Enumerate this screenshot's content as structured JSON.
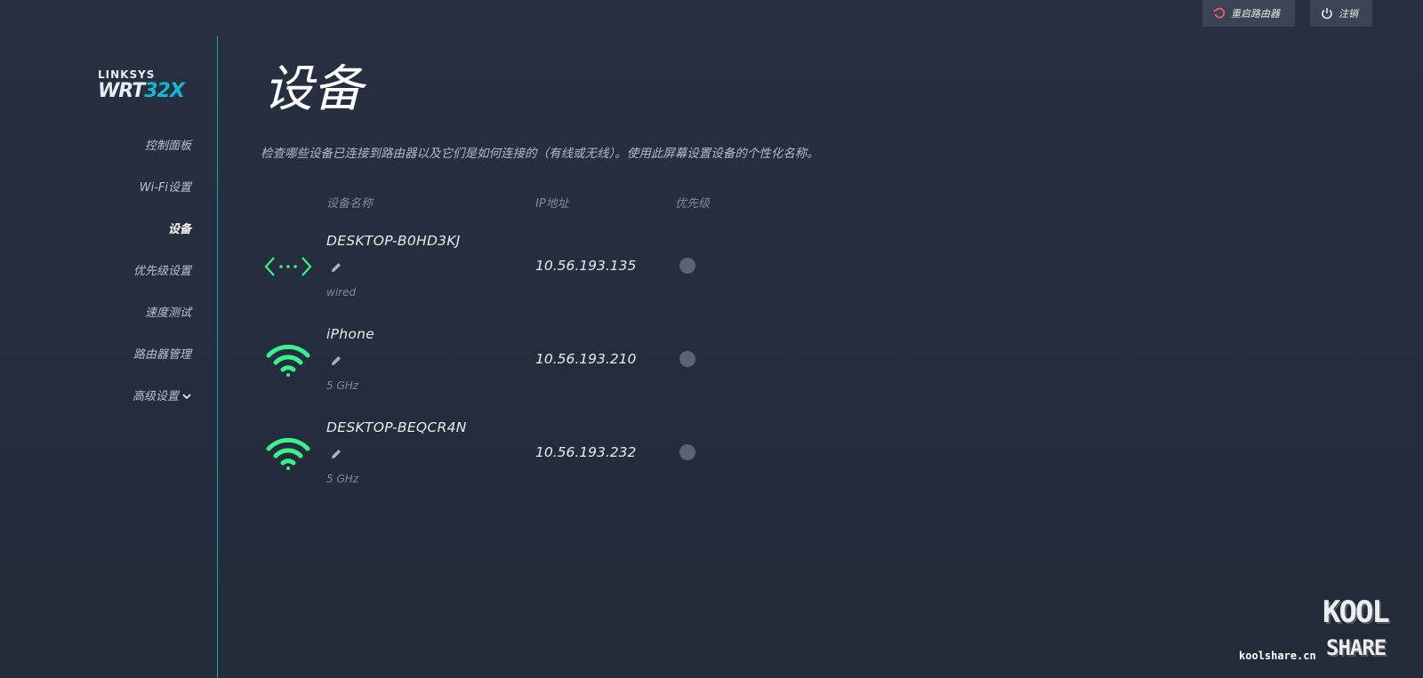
{
  "header": {
    "reboot_label": "重启路由器",
    "logout_label": "注销"
  },
  "logo": {
    "brand": "LINKSYS",
    "model_prefix": "WRT",
    "model_suffix": "32X"
  },
  "sidebar": {
    "items": [
      {
        "label": "控制面板"
      },
      {
        "label": "Wi-Fi设置"
      },
      {
        "label": "设备",
        "active": true
      },
      {
        "label": "优先级设置"
      },
      {
        "label": "速度测试"
      },
      {
        "label": "路由器管理"
      },
      {
        "label": "高级设置"
      }
    ]
  },
  "main": {
    "title": "设备",
    "subtitle": "检查哪些设备已连接到路由器以及它们是如何连接的（有线或无线）。使用此屏幕设置设备的个性化名称。",
    "columns": {
      "name": "设备名称",
      "ip": "IP地址",
      "priority": "优先级"
    },
    "devices": [
      {
        "name": "DESKTOP-B0HD3KJ",
        "type": "wired",
        "ip": "10.56.193.135",
        "icon": "wired-icon"
      },
      {
        "name": "iPhone",
        "type": "5 GHz",
        "ip": "10.56.193.210",
        "icon": "wifi-icon"
      },
      {
        "name": "DESKTOP-BEQCR4N",
        "type": "5 GHz",
        "ip": "10.56.193.232",
        "icon": "wifi-icon"
      }
    ]
  },
  "watermark": {
    "url": "koolshare.cn",
    "kool": "KOOL",
    "share": "SHARE"
  },
  "colors": {
    "accent": "#1ea3b8",
    "icon_green": "#3df08e",
    "background": "#242d3b"
  }
}
